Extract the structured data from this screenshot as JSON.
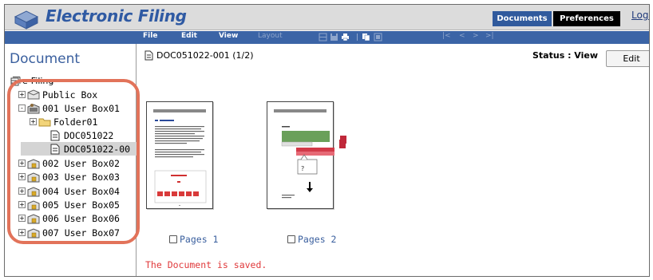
{
  "header": {
    "app_title": "Electronic Filing",
    "nav_documents": "Documents",
    "nav_preferences": "Preferences",
    "nav_login": "Logi"
  },
  "menubar": {
    "file": "File",
    "edit": "Edit",
    "view": "View",
    "layout": "Layout"
  },
  "sidebar": {
    "heading": "Document",
    "root": "e-Filing",
    "items": [
      {
        "label": "Public Box",
        "expander": "+",
        "icon": "public-box-icon"
      },
      {
        "label": "001 User Box01",
        "expander": "-",
        "icon": "user-box-open-icon"
      },
      {
        "label": "Folder01",
        "expander": "+",
        "icon": "folder-icon"
      },
      {
        "label": "DOC051022",
        "expander": "",
        "icon": "document-icon"
      },
      {
        "label": "DOC051022-00",
        "expander": "",
        "icon": "document-icon"
      },
      {
        "label": "002 User Box02",
        "expander": "+",
        "icon": "locked-box-icon"
      },
      {
        "label": "003 User Box03",
        "expander": "+",
        "icon": "locked-box-icon"
      },
      {
        "label": "004 User Box04",
        "expander": "+",
        "icon": "locked-box-icon"
      },
      {
        "label": "005 User Box05",
        "expander": "+",
        "icon": "locked-box-icon"
      },
      {
        "label": "006 User Box06",
        "expander": "+",
        "icon": "locked-box-icon"
      },
      {
        "label": "007 User Box07",
        "expander": "+",
        "icon": "locked-box-icon"
      }
    ],
    "selected_index": 4
  },
  "content": {
    "doc_path": "DOC051022-001  (1/2)",
    "status_label": "Status : View",
    "edit_button": "Edit",
    "pages": [
      {
        "label": "Pages 1"
      },
      {
        "label": "Pages 2"
      }
    ],
    "thumb_page2_mark": "?",
    "saved_message": "The Document is saved."
  },
  "colors": {
    "accent": "#3b64a6",
    "highlight_ring": "#e2735a",
    "saved_text": "#e0393b"
  }
}
